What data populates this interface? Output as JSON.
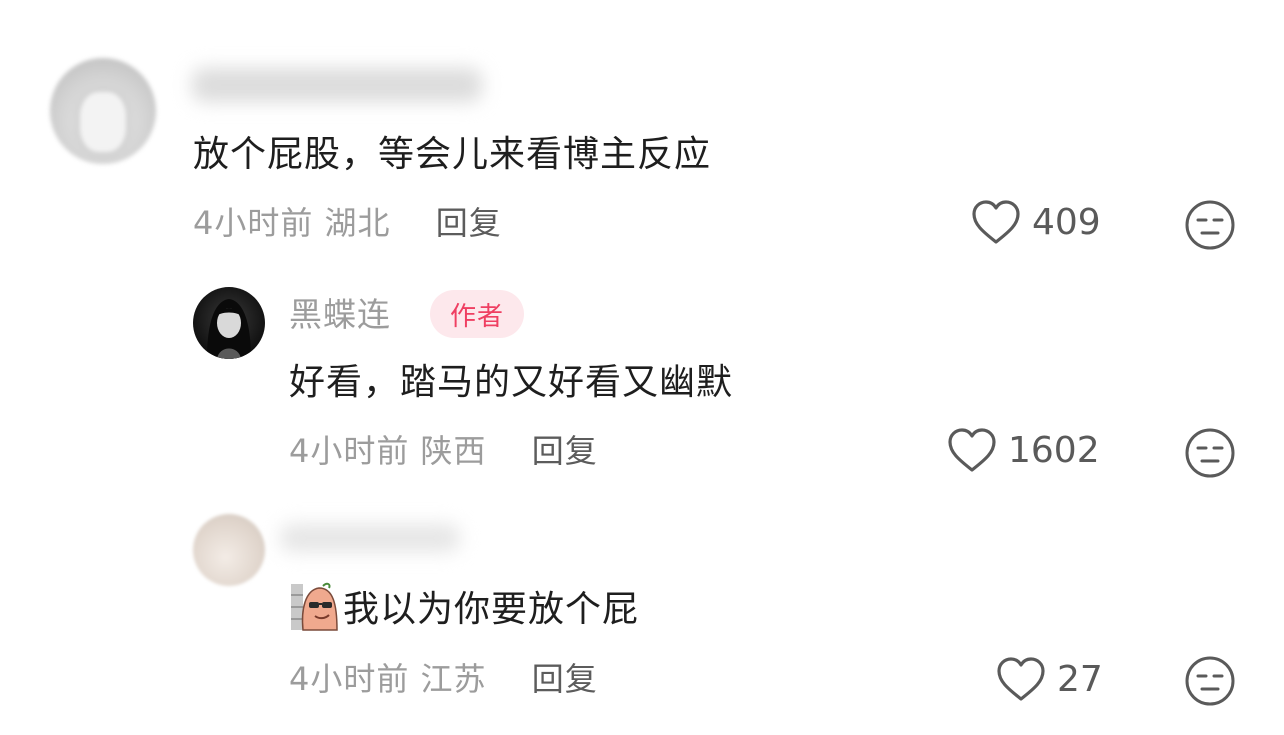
{
  "comments": [
    {
      "text": "放个屁股，等会儿来看博主反应",
      "time": "4小时前",
      "location": "湖北",
      "reply_label": "回复",
      "likes": "409"
    },
    {
      "author_name": "黑蝶连",
      "author_badge": "作者",
      "text": "好看，踏马的又好看又幽默",
      "time": "4小时前",
      "location": "陕西",
      "reply_label": "回复",
      "likes": "1602"
    },
    {
      "text": "我以为你要放个屁",
      "time": "4小时前",
      "location": "江苏",
      "reply_label": "回复",
      "likes": "27"
    }
  ],
  "colors": {
    "badge_bg": "#fde8ec",
    "badge_text": "#ef3f62",
    "meta_text": "#9c9c9c",
    "body_text": "#1e1e1e"
  },
  "icons": [
    "heart-icon",
    "neutral-face-icon",
    "sticker-emoji-icon"
  ]
}
